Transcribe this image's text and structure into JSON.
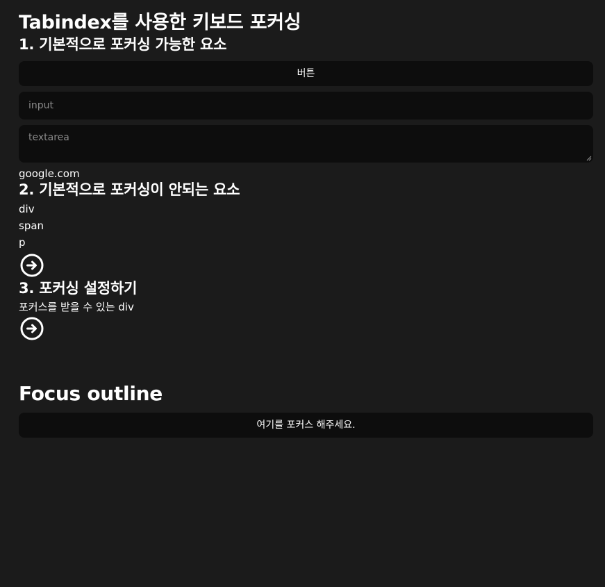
{
  "page_title": "Tabindex를 사용한 키보드 포커싱",
  "section1": {
    "heading": "1. 기본적으로 포커싱 가능한 요소",
    "button_label": "버튼",
    "input_placeholder": "input",
    "textarea_placeholder": "textarea",
    "link_text": "google.com"
  },
  "section2": {
    "heading": "2. 기본적으로 포커싱이 안되는 요소",
    "div_text": "div",
    "span_text": "span",
    "p_text": "p",
    "icon": "arrow-right-circle-icon"
  },
  "section3": {
    "heading": "3. 포커싱 설정하기",
    "focusable_div_text": "포커스를 받을 수 있는 div",
    "icon": "arrow-right-circle-icon"
  },
  "focus_outline": {
    "heading": "Focus outline",
    "button_label": "여기를 포커스 해주세요."
  },
  "colors": {
    "background": "#1b1b1b",
    "control_background": "#0d0d0d",
    "text": "#ffffff",
    "placeholder": "#8a8a8a"
  }
}
